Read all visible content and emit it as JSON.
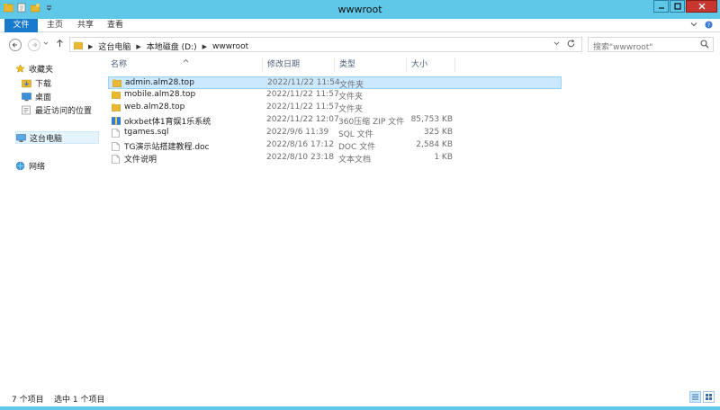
{
  "window": {
    "title": "wwwroot"
  },
  "ribbon": {
    "tabs": [
      {
        "label": "文件"
      },
      {
        "label": "主页"
      },
      {
        "label": "共享"
      },
      {
        "label": "查看"
      }
    ]
  },
  "address": {
    "crumbs": [
      "这台电脑",
      "本地磁盘 (D:)",
      "wwwroot"
    ]
  },
  "search": {
    "placeholder": "搜索\"wwwroot\""
  },
  "navpane": {
    "favorites": {
      "label": "收藏夹",
      "items": [
        {
          "label": "下载"
        },
        {
          "label": "桌面"
        },
        {
          "label": "最近访问的位置"
        }
      ]
    },
    "thispc": {
      "label": "这台电脑"
    },
    "network": {
      "label": "网络"
    }
  },
  "columns": {
    "name": "名称",
    "date": "修改日期",
    "type": "类型",
    "size": "大小"
  },
  "files": [
    {
      "name": "admin.alm28.top",
      "date": "2022/11/22 11:54",
      "type": "文件夹",
      "size": "",
      "icon": "folder-icon",
      "selected": true
    },
    {
      "name": "mobile.alm28.top",
      "date": "2022/11/22 11:57",
      "type": "文件夹",
      "size": "",
      "icon": "folder-icon",
      "selected": false
    },
    {
      "name": "web.alm28.top",
      "date": "2022/11/22 11:57",
      "type": "文件夹",
      "size": "",
      "icon": "folder-icon",
      "selected": false
    },
    {
      "name": "okxbet体1育娱1乐系统",
      "date": "2022/11/22 12:07",
      "type": "360压缩 ZIP 文件",
      "size": "85,753 KB",
      "icon": "zip-icon",
      "selected": false
    },
    {
      "name": "tgames.sql",
      "date": "2022/9/6 11:39",
      "type": "SQL 文件",
      "size": "325 KB",
      "icon": "file-icon",
      "selected": false
    },
    {
      "name": "TG演示站搭建教程.doc",
      "date": "2022/8/16 17:12",
      "type": "DOC 文件",
      "size": "2,584 KB",
      "icon": "file-icon",
      "selected": false
    },
    {
      "name": "文件说明",
      "date": "2022/8/10 23:18",
      "type": "文本文档",
      "size": "1 KB",
      "icon": "file-icon",
      "selected": false
    }
  ],
  "status": {
    "count": "7 个项目",
    "selection": "选中 1 个项目"
  },
  "colors": {
    "titlebar": "#5fc7e8",
    "file_tab": "#1979ca",
    "selection": "#cce8ff",
    "folder": "#e8b830"
  }
}
